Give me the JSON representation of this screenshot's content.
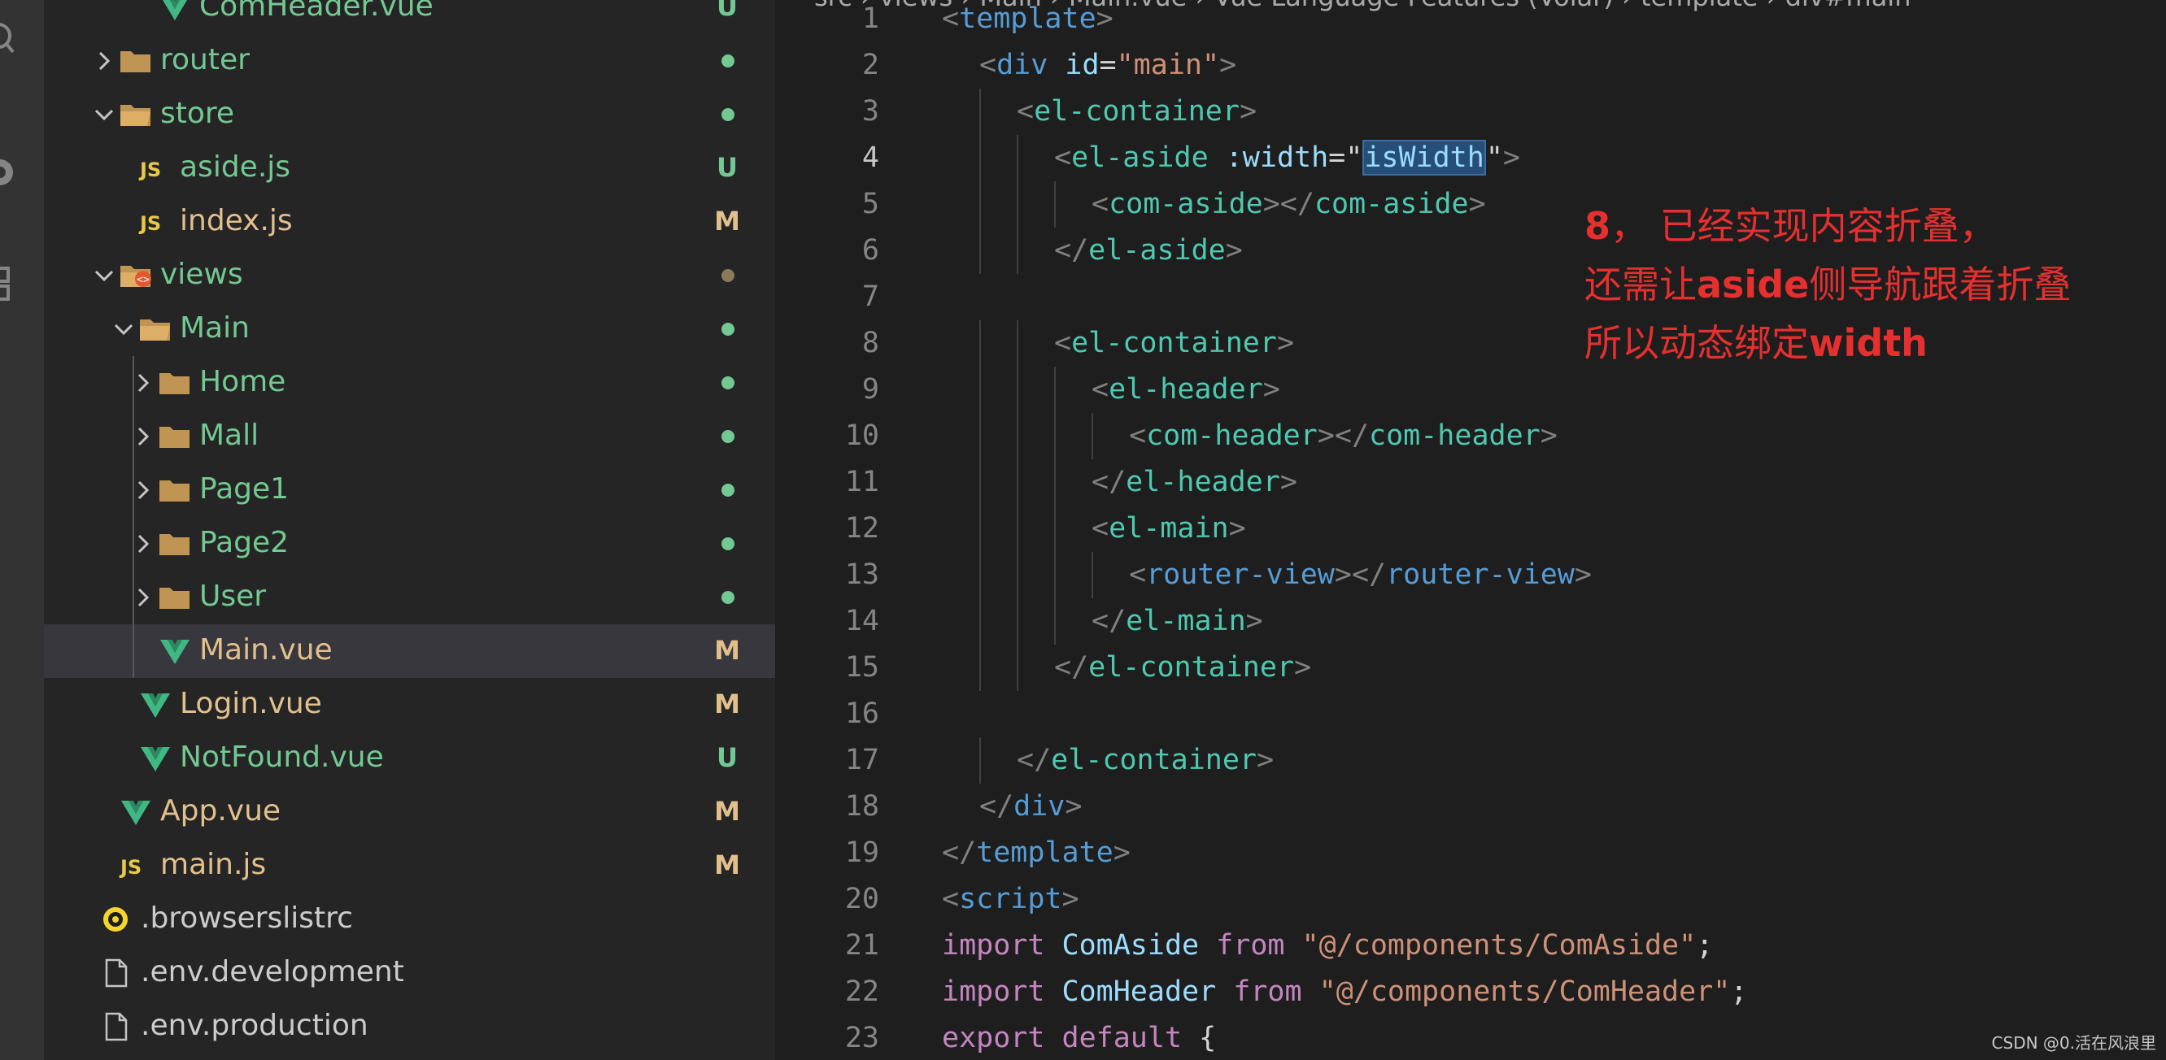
{
  "explorer": {
    "items": [
      {
        "name": "ComHeader.vue",
        "type": "vue",
        "level": 3,
        "expandable": false,
        "expanded": false,
        "color": "#73c991",
        "badge": "U",
        "badge_color": "#73c991",
        "dot": false
      },
      {
        "name": "router",
        "type": "folder",
        "level": 1,
        "expandable": true,
        "expanded": false,
        "color": "#73c991",
        "badge": "",
        "dot": true,
        "dot_color": "#73c991"
      },
      {
        "name": "store",
        "type": "folder-open",
        "level": 1,
        "expandable": true,
        "expanded": true,
        "color": "#73c991",
        "badge": "",
        "dot": true,
        "dot_color": "#73c991"
      },
      {
        "name": "aside.js",
        "type": "js",
        "level": 2,
        "expandable": false,
        "expanded": false,
        "color": "#73c991",
        "badge": "U",
        "badge_color": "#73c991",
        "dot": false
      },
      {
        "name": "index.js",
        "type": "js",
        "level": 2,
        "expandable": false,
        "expanded": false,
        "color": "#e2c08d",
        "badge": "M",
        "badge_color": "#e2c08d",
        "dot": false
      },
      {
        "name": "views",
        "type": "views-folder",
        "level": 1,
        "expandable": true,
        "expanded": true,
        "color": "#73c991",
        "badge": "",
        "dot": true,
        "dot_color": "#8b7a5a"
      },
      {
        "name": "Main",
        "type": "folder-open",
        "level": 2,
        "expandable": true,
        "expanded": true,
        "color": "#73c991",
        "badge": "",
        "dot": true,
        "dot_color": "#73c991"
      },
      {
        "name": "Home",
        "type": "folder",
        "level": 3,
        "expandable": true,
        "expanded": false,
        "color": "#73c991",
        "badge": "",
        "dot": true,
        "dot_color": "#73c991"
      },
      {
        "name": "Mall",
        "type": "folder",
        "level": 3,
        "expandable": true,
        "expanded": false,
        "color": "#73c991",
        "badge": "",
        "dot": true,
        "dot_color": "#73c991"
      },
      {
        "name": "Page1",
        "type": "folder",
        "level": 3,
        "expandable": true,
        "expanded": false,
        "color": "#73c991",
        "badge": "",
        "dot": true,
        "dot_color": "#73c991"
      },
      {
        "name": "Page2",
        "type": "folder",
        "level": 3,
        "expandable": true,
        "expanded": false,
        "color": "#73c991",
        "badge": "",
        "dot": true,
        "dot_color": "#73c991"
      },
      {
        "name": "User",
        "type": "folder",
        "level": 3,
        "expandable": true,
        "expanded": false,
        "color": "#73c991",
        "badge": "",
        "dot": true,
        "dot_color": "#73c991"
      },
      {
        "name": "Main.vue",
        "type": "vue",
        "level": 3,
        "expandable": false,
        "expanded": false,
        "color": "#e2c08d",
        "badge": "M",
        "badge_color": "#e2c08d",
        "dot": false,
        "selected": true
      },
      {
        "name": "Login.vue",
        "type": "vue",
        "level": 2,
        "expandable": false,
        "expanded": false,
        "color": "#e2c08d",
        "badge": "M",
        "badge_color": "#e2c08d",
        "dot": false
      },
      {
        "name": "NotFound.vue",
        "type": "vue",
        "level": 2,
        "expandable": false,
        "expanded": false,
        "color": "#73c991",
        "badge": "U",
        "badge_color": "#73c991",
        "dot": false
      },
      {
        "name": "App.vue",
        "type": "vue",
        "level": 1,
        "expandable": false,
        "expanded": false,
        "color": "#e2c08d",
        "badge": "M",
        "badge_color": "#e2c08d",
        "dot": false
      },
      {
        "name": "main.js",
        "type": "js",
        "level": 1,
        "expandable": false,
        "expanded": false,
        "color": "#e2c08d",
        "badge": "M",
        "badge_color": "#e2c08d",
        "dot": false
      },
      {
        "name": ".browserslistrc",
        "type": "browserslist",
        "level": 0,
        "expandable": false,
        "expanded": false,
        "color": "#cccccc",
        "badge": "",
        "dot": false
      },
      {
        "name": ".env.development",
        "type": "file",
        "level": 0,
        "expandable": false,
        "expanded": false,
        "color": "#cccccc",
        "badge": "",
        "dot": false
      },
      {
        "name": ".env.production",
        "type": "file",
        "level": 0,
        "expandable": false,
        "expanded": false,
        "color": "#cccccc",
        "badge": "",
        "dot": false
      }
    ]
  },
  "breadcrumb": "src › views › Main › Main.vue › Vue Language Features (Volar) › template › div#main",
  "editor": {
    "active_line": 4,
    "colors": {
      "tag": "#569cd6",
      "component": "#4ec9b0",
      "punct": "#808080",
      "attr": "#9cdcfe",
      "string": "#ce9178",
      "text": "#d4d4d4",
      "keyword": "#c586c0",
      "ident": "#9cdcfe"
    },
    "lines": [
      {
        "n": "1",
        "indent": 0,
        "tokens": [
          [
            "punct",
            "<"
          ],
          [
            "tag",
            "template"
          ],
          [
            "punct",
            ">"
          ]
        ]
      },
      {
        "n": "2",
        "indent": 1,
        "tokens": [
          [
            "punct",
            "<"
          ],
          [
            "tag",
            "div"
          ],
          [
            "text",
            " "
          ],
          [
            "attr",
            "id"
          ],
          [
            "text",
            "="
          ],
          [
            "string",
            "\"main\""
          ],
          [
            "punct",
            ">"
          ]
        ]
      },
      {
        "n": "3",
        "indent": 2,
        "tokens": [
          [
            "punct",
            "<"
          ],
          [
            "component",
            "el-container"
          ],
          [
            "punct",
            ">"
          ]
        ]
      },
      {
        "n": "4",
        "indent": 3,
        "tokens": [
          [
            "punct",
            "<"
          ],
          [
            "component",
            "el-aside"
          ],
          [
            "text",
            " "
          ],
          [
            "attr",
            ":width"
          ],
          [
            "text",
            "=\""
          ],
          [
            "sel",
            "isWidth"
          ],
          [
            "text",
            "\""
          ],
          [
            "punct",
            ">"
          ]
        ]
      },
      {
        "n": "5",
        "indent": 4,
        "tokens": [
          [
            "punct",
            "<"
          ],
          [
            "component",
            "com-aside"
          ],
          [
            "punct",
            "></"
          ],
          [
            "component",
            "com-aside"
          ],
          [
            "punct",
            ">"
          ]
        ]
      },
      {
        "n": "6",
        "indent": 3,
        "tokens": [
          [
            "punct",
            "</"
          ],
          [
            "component",
            "el-aside"
          ],
          [
            "punct",
            ">"
          ]
        ]
      },
      {
        "n": "7",
        "indent": 0,
        "tokens": []
      },
      {
        "n": "8",
        "indent": 3,
        "tokens": [
          [
            "punct",
            "<"
          ],
          [
            "component",
            "el-container"
          ],
          [
            "punct",
            ">"
          ]
        ]
      },
      {
        "n": "9",
        "indent": 4,
        "tokens": [
          [
            "punct",
            "<"
          ],
          [
            "component",
            "el-header"
          ],
          [
            "punct",
            ">"
          ]
        ]
      },
      {
        "n": "10",
        "indent": 5,
        "tokens": [
          [
            "punct",
            "<"
          ],
          [
            "component",
            "com-header"
          ],
          [
            "punct",
            "></"
          ],
          [
            "component",
            "com-header"
          ],
          [
            "punct",
            ">"
          ]
        ]
      },
      {
        "n": "11",
        "indent": 4,
        "tokens": [
          [
            "punct",
            "</"
          ],
          [
            "component",
            "el-header"
          ],
          [
            "punct",
            ">"
          ]
        ]
      },
      {
        "n": "12",
        "indent": 4,
        "tokens": [
          [
            "punct",
            "<"
          ],
          [
            "component",
            "el-main"
          ],
          [
            "punct",
            ">"
          ]
        ]
      },
      {
        "n": "13",
        "indent": 5,
        "tokens": [
          [
            "punct",
            "<"
          ],
          [
            "tag",
            "router-view"
          ],
          [
            "punct",
            "></"
          ],
          [
            "tag",
            "router-view"
          ],
          [
            "punct",
            ">"
          ]
        ]
      },
      {
        "n": "14",
        "indent": 4,
        "tokens": [
          [
            "punct",
            "</"
          ],
          [
            "component",
            "el-main"
          ],
          [
            "punct",
            ">"
          ]
        ]
      },
      {
        "n": "15",
        "indent": 3,
        "tokens": [
          [
            "punct",
            "</"
          ],
          [
            "component",
            "el-container"
          ],
          [
            "punct",
            ">"
          ]
        ]
      },
      {
        "n": "16",
        "indent": 0,
        "tokens": []
      },
      {
        "n": "17",
        "indent": 2,
        "tokens": [
          [
            "punct",
            "</"
          ],
          [
            "component",
            "el-container"
          ],
          [
            "punct",
            ">"
          ]
        ]
      },
      {
        "n": "18",
        "indent": 1,
        "tokens": [
          [
            "punct",
            "</"
          ],
          [
            "tag",
            "div"
          ],
          [
            "punct",
            ">"
          ]
        ]
      },
      {
        "n": "19",
        "indent": 0,
        "tokens": [
          [
            "punct",
            "</"
          ],
          [
            "tag",
            "template"
          ],
          [
            "punct",
            ">"
          ]
        ]
      },
      {
        "n": "20",
        "indent": 0,
        "tokens": [
          [
            "punct",
            "<"
          ],
          [
            "tag",
            "script"
          ],
          [
            "punct",
            ">"
          ]
        ]
      },
      {
        "n": "21",
        "indent": 0,
        "tokens": [
          [
            "keyword",
            "import"
          ],
          [
            "text",
            " "
          ],
          [
            "ident",
            "ComAside"
          ],
          [
            "text",
            " "
          ],
          [
            "keyword",
            "from"
          ],
          [
            "text",
            " "
          ],
          [
            "string",
            "\"@/components/ComAside\""
          ],
          [
            "text",
            ";"
          ]
        ]
      },
      {
        "n": "22",
        "indent": 0,
        "tokens": [
          [
            "keyword",
            "import"
          ],
          [
            "text",
            " "
          ],
          [
            "ident",
            "ComHeader"
          ],
          [
            "text",
            " "
          ],
          [
            "keyword",
            "from"
          ],
          [
            "text",
            " "
          ],
          [
            "string",
            "\"@/components/ComHeader\""
          ],
          [
            "text",
            ";"
          ]
        ]
      },
      {
        "n": "23",
        "indent": 0,
        "tokens": [
          [
            "keyword",
            "export"
          ],
          [
            "text",
            " "
          ],
          [
            "keyword",
            "default"
          ],
          [
            "text",
            " {"
          ]
        ]
      }
    ]
  },
  "annotation": {
    "lines": [
      [
        {
          "t": "8",
          "b": true
        },
        {
          "t": "，  已经实现内容折叠，",
          "b": false
        }
      ],
      [
        {
          "t": "还需让",
          "b": false
        },
        {
          "t": "aside",
          "b": true
        },
        {
          "t": "侧导航跟着折叠",
          "b": false
        }
      ],
      [
        {
          "t": "所以动态绑定",
          "b": false
        },
        {
          "t": "width",
          "b": true
        }
      ]
    ]
  },
  "watermark": "CSDN @0.活在风浪里"
}
